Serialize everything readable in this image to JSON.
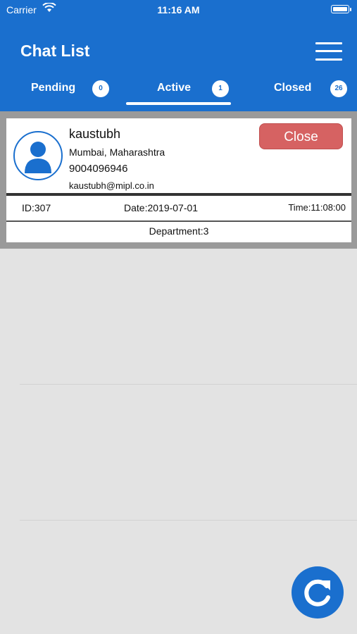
{
  "status_bar": {
    "carrier": "Carrier",
    "time": "11:16 AM"
  },
  "header": {
    "title": "Chat List"
  },
  "tabs": [
    {
      "label": "Pending",
      "count": "0"
    },
    {
      "label": "Active",
      "count": "1",
      "selected": true
    },
    {
      "label": "Closed",
      "count": "26"
    }
  ],
  "chat": {
    "name": "kaustubh",
    "location": "Mumbai, Maharashtra",
    "phone": "9004096946",
    "email": "kaustubh@mipl.co.in",
    "close_label": "Close",
    "id": "ID:307",
    "date": "Date:2019-07-01",
    "time": "Time:11:08:00",
    "department": "Department:3"
  },
  "colors": {
    "primary": "#1a6fce",
    "close_button": "#d66262",
    "background": "#e3e3e3"
  },
  "icons": {
    "menu": "hamburger-menu-icon",
    "refresh": "refresh-icon",
    "avatar": "user-avatar-icon"
  }
}
